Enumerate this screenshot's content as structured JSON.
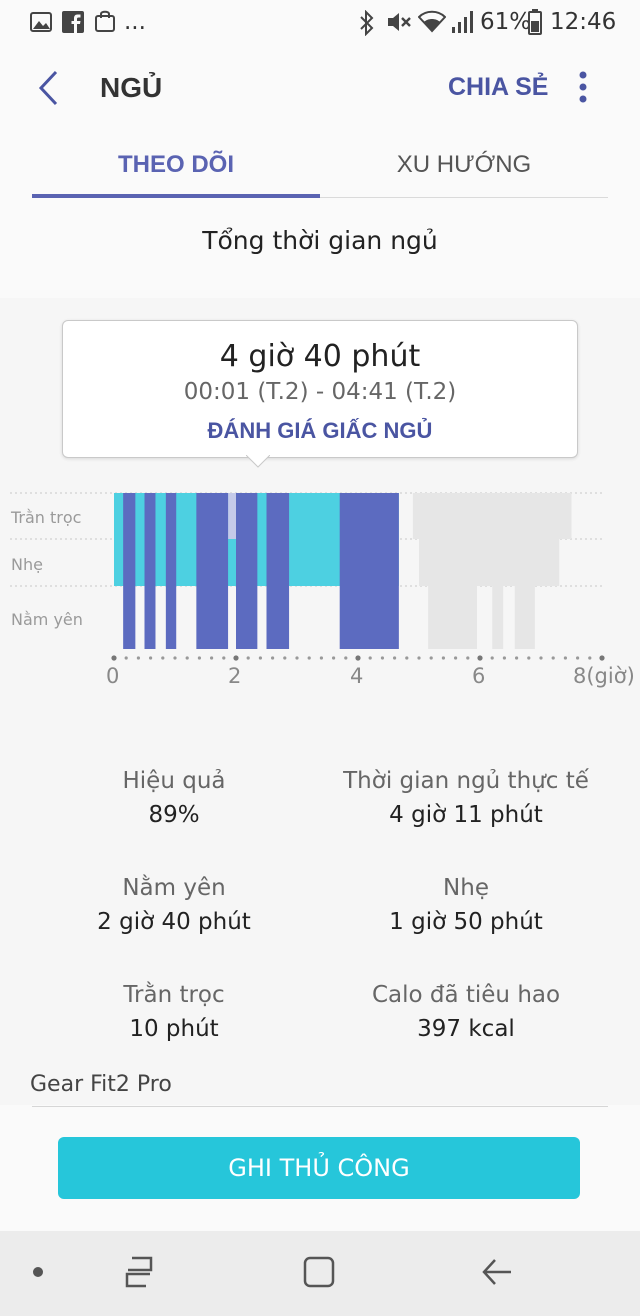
{
  "status_bar": {
    "more": "...",
    "battery": "61%",
    "time": "12:46"
  },
  "header": {
    "title": "NGỦ",
    "share_label": "CHIA SẺ",
    "tabs": [
      {
        "label": "THEO DÕI",
        "active": true
      },
      {
        "label": "XU HƯỚNG",
        "active": false
      }
    ]
  },
  "section_title": "Tổng thời gian ngủ",
  "tooltip": {
    "duration": "4 giờ 40 phút",
    "time_range": "00:01 (T.2) - 04:41 (T.2)",
    "action": "ĐÁNH GIÁ GIẤC NGỦ"
  },
  "chart_data": {
    "type": "bar",
    "title": "",
    "y_levels": [
      "Trằn trọc",
      "Nhẹ",
      "Nằm yên"
    ],
    "x_ticks": [
      "0",
      "2",
      "4",
      "6",
      "8(giờ)"
    ],
    "xlim": [
      0,
      8
    ],
    "x_unit": "giờ",
    "colors": {
      "restless": "#5c6bc0",
      "light": "#4dd0e1",
      "deep": "#5c6bc0",
      "awake_highlight": "#c5cae9",
      "other_session": "#e6e6e6"
    },
    "current_session": {
      "light_segments": [
        [
          0.0,
          4.67
        ]
      ],
      "deep_segments": [
        [
          0.15,
          0.35
        ],
        [
          0.5,
          0.68
        ],
        [
          0.85,
          1.02
        ],
        [
          1.35,
          1.87
        ],
        [
          2.0,
          2.35
        ],
        [
          2.5,
          2.87
        ],
        [
          3.7,
          4.67
        ]
      ],
      "awake_segments": [
        [
          1.87,
          2.0
        ]
      ]
    },
    "other_session": {
      "restless_segments": [
        [
          4.9,
          7.5
        ]
      ],
      "light_segments": [
        [
          5.0,
          7.3
        ]
      ],
      "deep_segments": [
        [
          5.15,
          5.95
        ],
        [
          6.2,
          6.38
        ],
        [
          6.57,
          6.9
        ]
      ]
    }
  },
  "stats": [
    {
      "label": "Hiệu quả",
      "value": "89%"
    },
    {
      "label": "Thời gian ngủ thực tế",
      "value": "4 giờ 11 phút"
    },
    {
      "label": "Nằm yên",
      "value": "2 giờ 40 phút"
    },
    {
      "label": "Nhẹ",
      "value": "1 giờ 50 phút"
    },
    {
      "label": "Trằn trọc",
      "value": "10 phút"
    },
    {
      "label": "Calo đã tiêu hao",
      "value": "397 kcal"
    }
  ],
  "device": "Gear Fit2 Pro",
  "manual_button": "GHI THỦ CÔNG"
}
